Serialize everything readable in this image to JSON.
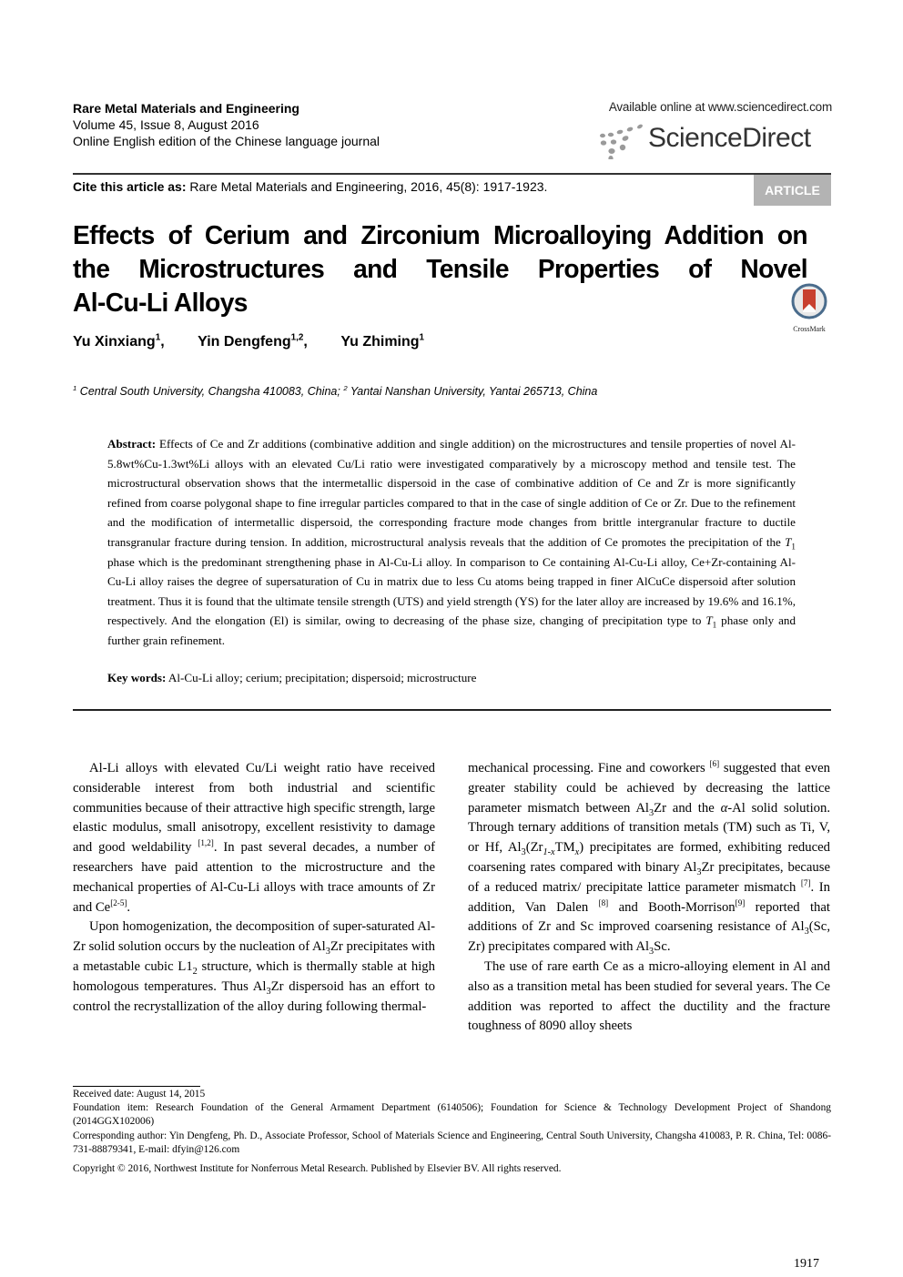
{
  "header": {
    "journal_name": "Rare Metal Materials and Engineering",
    "volume_issue": "Volume 45, Issue 8, August 2016",
    "edition_note": "Online English edition of the Chinese language journal",
    "available_online": "Available online at www.sciencedirect.com",
    "publisher_logo_text": "ScienceDirect",
    "cite_label": "Cite this article as:",
    "cite_text": " Rare Metal Materials and Engineering, 2016, 45(8): 1917-1923.",
    "article_type_badge": "ARTICLE",
    "crossmark_label": "CrossMark"
  },
  "colors": {
    "badge_bg": "#b3b3b3",
    "badge_text": "#ffffff",
    "crossmark_red": "#c8402f",
    "crossmark_ring": "#4a6c8c",
    "logo_gray": "#999999"
  },
  "title": {
    "lines": [
      "Effects of Cerium and Zirconium Microalloying Addition on",
      "the Microstructures and Tensile Properties of Novel",
      "Al-Cu-Li Alloys"
    ]
  },
  "authors": [
    {
      "name": "Yu Xinxiang",
      "affil": "1",
      "sep": ","
    },
    {
      "name": "Yin Dengfeng",
      "affil": "1,2",
      "sep": ","
    },
    {
      "name": "Yu Zhiming",
      "affil": "1",
      "sep": ""
    }
  ],
  "affiliations": [
    {
      "num": "1",
      "text": " Central South University, Changsha 410083, China; "
    },
    {
      "num": "2",
      "text": " Yantai Nanshan University, Yantai 265713, China"
    }
  ],
  "abstract": {
    "label": "Abstract:",
    "part1": " Effects of Ce and Zr additions (combinative addition and single addition) on the microstructures and tensile properties of novel Al-5.8wt%Cu-1.3wt%Li alloys with an elevated Cu/Li ratio were investigated comparatively by a microscopy method and tensile test. The microstructural observation shows that the intermetallic dispersoid in the case of combinative addition of Ce and Zr is more significantly refined from coarse polygonal shape to fine irregular particles compared to that in the case of single addition of Ce or Zr. Due to the refinement and the modification of intermetallic dispersoid, the corresponding fracture mode changes from brittle intergranular fracture to ductile transgranular fracture during tension. In addition, microstructural analysis reveals that the addition of Ce promotes the precipitation of the ",
    "t1_symbol": "T",
    "t1_sub": "1",
    "part2": " phase which is the predominant strengthening phase in Al-Cu-Li alloy. In comparison to Ce containing Al-Cu-Li alloy, Ce+Zr-containing Al-Cu-Li alloy raises the degree of supersaturation of Cu in matrix due to less Cu atoms being trapped in finer AlCuCe dispersoid after solution treatment. Thus it is found that the ultimate tensile strength (UTS) and yield strength (YS) for the later alloy are increased by 19.6% and 16.1%, respectively. And the elongation (El) is similar, owing to decreasing of the phase size, changing of precipitation type to ",
    "part3": " phase only and further grain refinement."
  },
  "keywords": {
    "label": "Key words:",
    "text": " Al-Cu-Li alloy; cerium; precipitation; dispersoid; microstructure"
  },
  "body": {
    "left": {
      "p1a": "Al-Li alloys with elevated Cu/Li weight ratio have received considerable interest from both industrial and scientific communities because of their attractive high specific strength, large elastic modulus, small anisotropy, excellent resistivity to damage and good weldability ",
      "p1_ref1": "[1,2]",
      "p1b": ". In past several decades, a number of researchers have paid attention to the microstructure and the mechanical properties of Al-Cu-Li alloys with trace amounts of Zr and Ce",
      "p1_ref2": "[2-5]",
      "p1c": ".",
      "p2a": "Upon homogenization, the decomposition of super-saturated Al-Zr solid solution occurs by the nucleation of Al",
      "p2b": "Zr precipitates with a metastable cubic L1",
      "p2c": " structure, which is thermally stable at high homologous temperatures. Thus Al",
      "p2d": "Zr dispersoid has an effort to control the recrystallization of the alloy during following thermal-",
      "sub3": "3",
      "sub2": "2"
    },
    "right": {
      "p1a": "mechanical processing. Fine and coworkers ",
      "ref6": "[6]",
      "p1b": " suggested that even greater stability could be achieved by decreasing the lattice parameter mismatch between Al",
      "p1c": "Zr and the ",
      "alpha": "α",
      "p1d": "-Al solid solution. Through ternary additions of transition metals (TM) such as Ti, V, or Hf, Al",
      "p1e": "(Zr",
      "sub_1x": "1-x",
      "p1f": "TM",
      "sub_x": "x",
      "p1g": ") precipitates are formed, exhibiting reduced coarsening rates compared with binary Al",
      "p1h": "Zr precipitates, because of a reduced matrix/ precipitate lattice parameter mismatch ",
      "ref7": "[7]",
      "p1i": ". In addition, Van Dalen ",
      "ref8": "[8]",
      "p1j": " and Booth-Morrison",
      "ref9": "[9]",
      "p1k": " reported that additions of Zr and Sc improved coarsening resistance of Al",
      "p1l": "(Sc, Zr) precipitates compared with Al",
      "p1m": "Sc.",
      "p2": "The use of rare earth Ce as a micro-alloying element in Al and also as a transition metal has been studied for several years. The Ce addition was reported to affect the ductility and the fracture toughness of 8090 alloy sheets",
      "sub3": "3"
    }
  },
  "footnotes": {
    "received": "Received date: August 14, 2015",
    "foundation": "Foundation item: Research Foundation of the General Armament Department (6140506); Foundation for Science & Technology Development Project of Shandong (2014GGX102006)",
    "corresponding": "Corresponding author: Yin Dengfeng, Ph. D., Associate Professor, School of Materials Science and Engineering, Central South University, Changsha 410083, P. R. China, Tel: 0086-731-88879341, E-mail: dfyin@126.com",
    "copyright": "Copyright © 2016, Northwest Institute for Nonferrous Metal Research. Published by Elsevier BV. All rights reserved."
  },
  "page_number": "1917"
}
